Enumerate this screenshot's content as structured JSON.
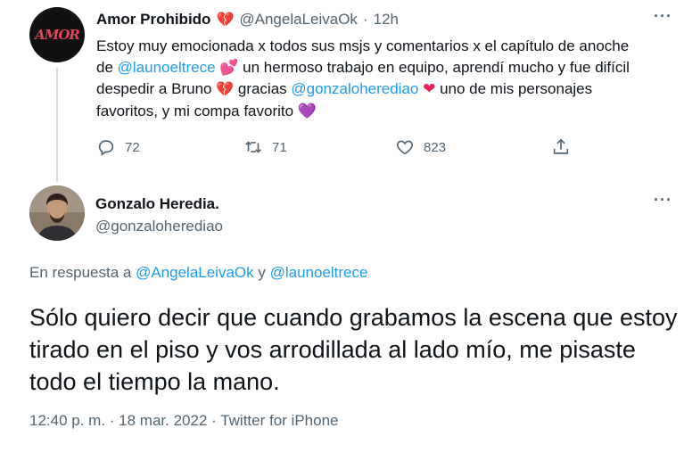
{
  "tweet1": {
    "display_name": "Amor Prohibido",
    "handle": "@AngelaLeivaOk",
    "separator": "·",
    "time": "12h",
    "avatar_text": "AMOR",
    "text_1": "Estoy muy emocionada x todos sus msjs y comentarios x el capítulo de anoche de ",
    "mention_1": "@launoeltrece",
    "text_2": " un hermoso trabajo en equipo, aprendí mucho y fue difícil despedir a Bruno ",
    "text_3": "gracias ",
    "mention_2": "@gonzaloherediao",
    "text_4": " uno de mis personajes favoritos, y mi compa favorito ",
    "replies": "72",
    "retweets": "71",
    "likes": "823"
  },
  "tweet2": {
    "display_name": "Gonzalo Heredia.",
    "handle": "@gonzaloherediao",
    "reply_prefix": "En respuesta a ",
    "reply_mention_1": "@AngelaLeivaOk",
    "reply_and": " y ",
    "reply_mention_2": "@launoeltrece",
    "text": "Sólo quiero decir que cuando grabamos la escena que estoy tirado en el piso y vos arrodillada al lado mío, me pisaste todo el tiempo la mano.",
    "timestamp": "12:40 p. m. · 18 mar. 2022 · Twitter for iPhone"
  },
  "icons": {
    "more": "more-icon",
    "reply": "reply-icon",
    "retweet": "retweet-icon",
    "like": "like-icon",
    "share": "share-icon",
    "broken_heart": "broken-heart-emoji",
    "heart": "heart-emoji",
    "purple_heart": "purple-heart-emoji"
  },
  "colors": {
    "link": "#1d9bf0",
    "muted": "#536471",
    "heart": "#e0245e",
    "purple": "#aa8ed6"
  }
}
